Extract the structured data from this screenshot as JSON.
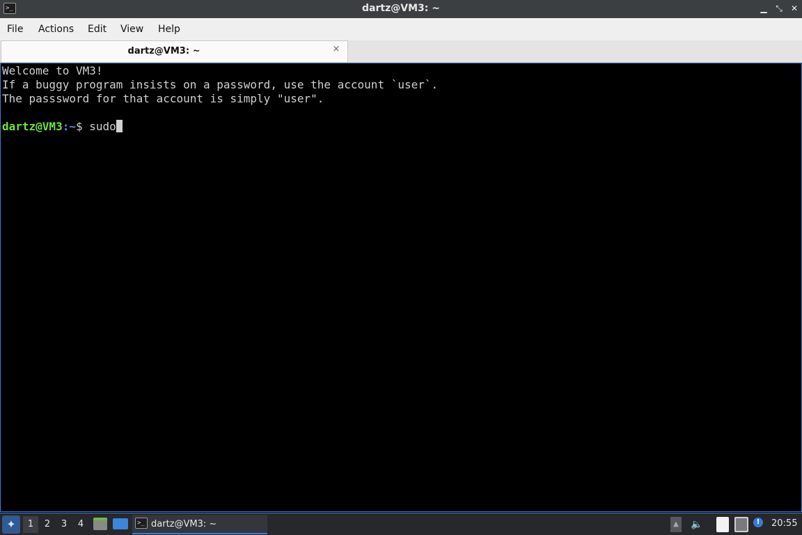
{
  "window": {
    "title": "dartz@VM3: ~",
    "icon": "terminal-icon",
    "buttons": [
      "minimize",
      "maximize",
      "close"
    ]
  },
  "menu": [
    "File",
    "Actions",
    "Edit",
    "View",
    "Help"
  ],
  "tab": {
    "label": "dartz@VM3: ~",
    "close_glyph": "×"
  },
  "terminal": {
    "lines": [
      "Welcome to VM3!",
      "If a buggy program insists on a password, use the account `user`.",
      "The passsword for that account is simply \"user\"."
    ],
    "prompt": {
      "user_host": "dartz@VM3",
      "sep": ":",
      "path": "~",
      "symbol": "$ ",
      "command": "sudo"
    },
    "colors": {
      "background": "#000000",
      "foreground": "#d0d0d0",
      "user_host": "#6ee33a",
      "path": "#6d8fd6"
    }
  },
  "taskbar": {
    "desktops": [
      "1",
      "2",
      "3",
      "4"
    ],
    "active_desktop": "1",
    "task_label": "dartz@VM3: ~",
    "clock": "20:55"
  }
}
